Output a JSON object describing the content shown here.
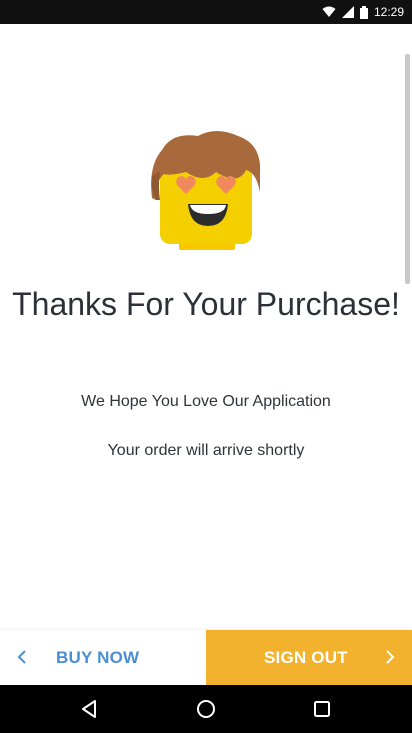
{
  "status_bar": {
    "time": "12:29",
    "icons": [
      "wifi-icon",
      "cell-signal-icon",
      "battery-icon"
    ]
  },
  "main": {
    "mascot_icon": "heart-eyes-mascot",
    "title": "Thanks For Your Purchase!",
    "subtitle": "We Hope You Love Our Application",
    "message": "Your order will arrive shortly"
  },
  "bottom_bar": {
    "buy_now_label": "BUY NOW",
    "sign_out_label": "SIGN OUT",
    "accent_color": "#f3b22d",
    "link_color": "#4a8fd2"
  },
  "nav_bar": {
    "icons": [
      "back-icon",
      "home-icon",
      "recents-icon"
    ]
  }
}
